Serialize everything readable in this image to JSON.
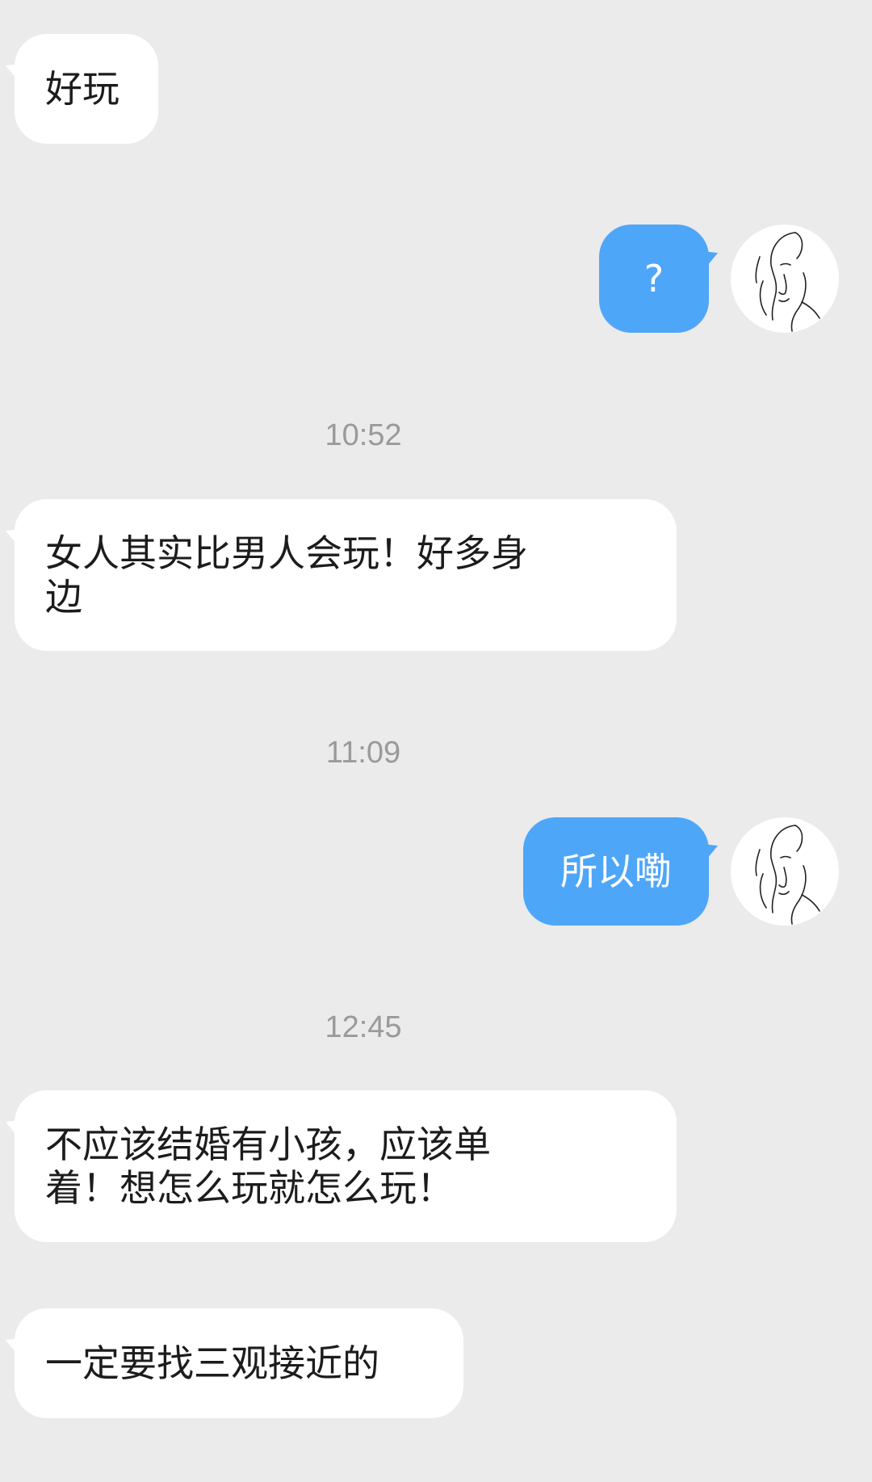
{
  "messages": [
    {
      "side": "incoming",
      "text": "好玩"
    },
    {
      "side": "outgoing",
      "text": "?"
    },
    {
      "type": "time",
      "text": "10:52"
    },
    {
      "side": "incoming",
      "text": "女人其实比男人会玩！好多身\n边"
    },
    {
      "type": "time",
      "text": "11:09"
    },
    {
      "side": "outgoing",
      "text": "所以嘞"
    },
    {
      "type": "time",
      "text": "12:45"
    },
    {
      "side": "incoming",
      "text": "不应该结婚有小孩，应该单\n着！想怎么玩就怎么玩！"
    },
    {
      "side": "incoming",
      "text": "一定要找三观接近的"
    }
  ],
  "avatar": {
    "icon": "line-art-face-avatar-icon"
  },
  "colors": {
    "background": "#ebebeb",
    "incoming_bubble": "#ffffff",
    "outgoing_bubble": "#4ea6f9",
    "timestamp": "#9a9a9a"
  }
}
